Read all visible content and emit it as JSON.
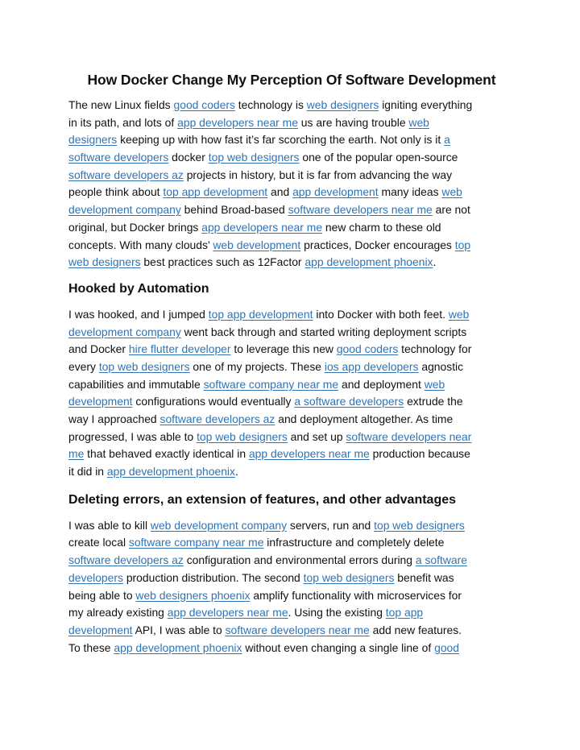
{
  "document": {
    "title": "How Docker Change My Perception Of Software Development",
    "link_color": "#2e74b5",
    "sections": [
      {
        "heading": null,
        "lines": [
          [
            [
              "t",
              "The new Linux fields "
            ],
            [
              "l",
              "good coders"
            ],
            [
              "t",
              " technology is "
            ],
            [
              "l",
              "web designers"
            ],
            [
              "t",
              " igniting everything"
            ]
          ],
          [
            [
              "t",
              "in its path, and lots of "
            ],
            [
              "l",
              "app developers near me"
            ],
            [
              "t",
              " us are having trouble "
            ],
            [
              "l",
              "web"
            ]
          ],
          [
            [
              "l",
              "designers"
            ],
            [
              "t",
              " keeping up with how fast it’s far scorching the earth.  Not only is it "
            ],
            [
              "l",
              "a"
            ]
          ],
          [
            [
              "l",
              "software developers"
            ],
            [
              "t",
              " docker "
            ],
            [
              "l",
              "top web designers"
            ],
            [
              "t",
              " one of the popular open-source"
            ]
          ],
          [
            [
              "l",
              "software developers az"
            ],
            [
              "t",
              " projects in history, but it is far from advancing the way"
            ]
          ],
          [
            [
              "t",
              "people think about "
            ],
            [
              "l",
              "top app development"
            ],
            [
              "t",
              " and "
            ],
            [
              "l",
              "app development"
            ],
            [
              "t",
              " many ideas "
            ],
            [
              "l",
              "web"
            ]
          ],
          [
            [
              "l",
              "development company"
            ],
            [
              "t",
              " behind Broad-based "
            ],
            [
              "l",
              "software developers near me"
            ],
            [
              "t",
              " are not"
            ]
          ],
          [
            [
              "t",
              "original, but Docker brings "
            ],
            [
              "l",
              "app developers near me"
            ],
            [
              "t",
              " new charm to these old"
            ]
          ],
          [
            [
              "t",
              "concepts. With many clouds’ "
            ],
            [
              "l",
              "web development"
            ],
            [
              "t",
              " practices, Docker encourages "
            ],
            [
              "l",
              "top"
            ]
          ],
          [
            [
              "l",
              "web designers"
            ],
            [
              "t",
              " best practices such as 12Factor "
            ],
            [
              "l",
              "app development phoenix"
            ],
            [
              "t",
              "."
            ]
          ]
        ]
      },
      {
        "heading": "Hooked by Automation",
        "lines": [
          [
            [
              "t",
              "I was hooked, and I jumped "
            ],
            [
              "l",
              "top app development"
            ],
            [
              "t",
              " into Docker with both feet. "
            ],
            [
              "l",
              "web"
            ]
          ],
          [
            [
              "l",
              "development company"
            ],
            [
              "t",
              " went back through and started writing deployment scripts"
            ]
          ],
          [
            [
              "t",
              "and Docker "
            ],
            [
              "l",
              "hire flutter developer"
            ],
            [
              "t",
              " to leverage this new "
            ],
            [
              "l",
              "good coders"
            ],
            [
              "t",
              " technology for"
            ]
          ],
          [
            [
              "t",
              "every "
            ],
            [
              "l",
              "top web designers"
            ],
            [
              "t",
              " one of my projects. These "
            ],
            [
              "l",
              "ios app developers"
            ],
            [
              "t",
              " agnostic"
            ]
          ],
          [
            [
              "t",
              "capabilities and immutable "
            ],
            [
              "l",
              "software company near me"
            ],
            [
              "t",
              " and deployment "
            ],
            [
              "l",
              "web"
            ]
          ],
          [
            [
              "l",
              "development"
            ],
            [
              "t",
              " configurations would eventually "
            ],
            [
              "l",
              "a software developers"
            ],
            [
              "t",
              " extrude the"
            ]
          ],
          [
            [
              "t",
              "way I approached "
            ],
            [
              "l",
              "software developers az"
            ],
            [
              "t",
              " and deployment altogether. As time"
            ]
          ],
          [
            [
              "t",
              "progressed, I was able to "
            ],
            [
              "l",
              "top web designers"
            ],
            [
              "t",
              " and set up "
            ],
            [
              "l",
              "software developers near"
            ]
          ],
          [
            [
              "l",
              "me"
            ],
            [
              "t",
              " that behaved exactly identical in "
            ],
            [
              "l",
              "app developers near me"
            ],
            [
              "t",
              " production because"
            ]
          ],
          [
            [
              "t",
              "it did in "
            ],
            [
              "l",
              "app development phoenix"
            ],
            [
              "t",
              "."
            ]
          ]
        ]
      },
      {
        "heading": "Deleting errors, an extension of features, and other advantages",
        "lines": [
          [
            [
              "t",
              "I was able to kill "
            ],
            [
              "l",
              "web development company"
            ],
            [
              "t",
              " servers, run and "
            ],
            [
              "l",
              "top web designers"
            ]
          ],
          [
            [
              "t",
              "create local "
            ],
            [
              "l",
              "software company near me"
            ],
            [
              "t",
              " infrastructure and completely delete"
            ]
          ],
          [
            [
              "l",
              "software developers az"
            ],
            [
              "t",
              " configuration and environmental errors during "
            ],
            [
              "l",
              "a software"
            ]
          ],
          [
            [
              "l",
              "developers"
            ],
            [
              "t",
              " production distribution. The second "
            ],
            [
              "l",
              "top web designers"
            ],
            [
              "t",
              "  benefit was"
            ]
          ],
          [
            [
              "t",
              "being able to "
            ],
            [
              "l",
              "web designers phoenix"
            ],
            [
              "t",
              " amplify functionality with microservices for"
            ]
          ],
          [
            [
              "t",
              "my already existing "
            ],
            [
              "l",
              "app developers near me"
            ],
            [
              "t",
              ". Using the existing "
            ],
            [
              "l",
              "top app"
            ]
          ],
          [
            [
              "l",
              "development"
            ],
            [
              "t",
              " API, I was able to "
            ],
            [
              "l",
              "software developers near me"
            ],
            [
              "t",
              " add new features."
            ]
          ],
          [
            [
              "t",
              "To these "
            ],
            [
              "l",
              "app development phoenix"
            ],
            [
              "t",
              "  without even changing a single line of "
            ],
            [
              "l",
              "good"
            ]
          ]
        ]
      }
    ]
  }
}
